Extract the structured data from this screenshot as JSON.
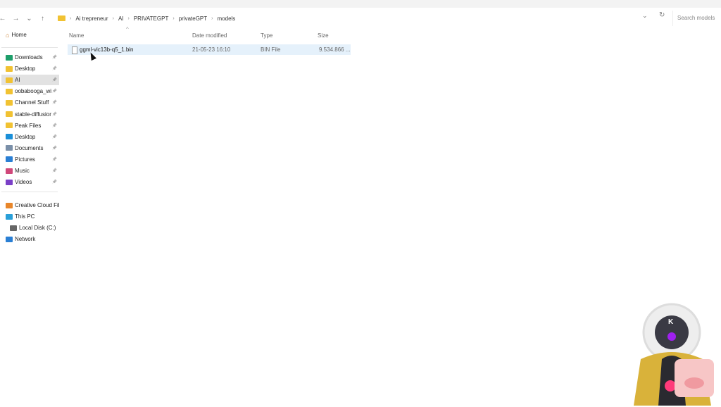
{
  "nav": {
    "back": "←",
    "forward": "→",
    "recent": "⌄",
    "up": "↑"
  },
  "breadcrumb": [
    "Ai trepreneur",
    "AI",
    "PRIVATEGPT",
    "privateGPT",
    "models"
  ],
  "breadcrumb_sep": "›",
  "dropdown": "⌄",
  "refresh": "↻",
  "search": {
    "placeholder": "Search models"
  },
  "sidebar": {
    "home": "Home",
    "quick": [
      {
        "label": "Downloads",
        "color": "#1e9e6a"
      },
      {
        "label": "Desktop",
        "color": "#f1c232"
      },
      {
        "label": "AI",
        "color": "#f1c232"
      },
      {
        "label": "oobabooga_wi",
        "color": "#f1c232"
      },
      {
        "label": "Channel Stuff",
        "color": "#f1c232"
      },
      {
        "label": "stable-diffusior",
        "color": "#f1c232"
      },
      {
        "label": "Peak Files",
        "color": "#f1c232"
      },
      {
        "label": "Desktop",
        "color": "#1a8fd8"
      },
      {
        "label": "Documents",
        "color": "#7a8fa8"
      },
      {
        "label": "Pictures",
        "color": "#2a7fd4"
      },
      {
        "label": "Music",
        "color": "#d0477a"
      },
      {
        "label": "Videos",
        "color": "#7a3fc7"
      }
    ],
    "other": [
      {
        "label": "Creative Cloud File",
        "color": "#e8862a"
      },
      {
        "label": "This PC",
        "color": "#2a9fd8"
      },
      {
        "label": "Local Disk (C:)",
        "color": "#666"
      },
      {
        "label": "Network",
        "color": "#2a7fd4"
      }
    ],
    "pin": "📌"
  },
  "columns": {
    "name": "Name",
    "date": "Date modified",
    "type": "Type",
    "size": "Size"
  },
  "files": [
    {
      "name": "ggml-vic13b-q5_1.bin",
      "date": "21-05-23 16:10",
      "type": "BIN File",
      "size": "9.534.866 ..."
    }
  ],
  "webcam": {
    "badge": "K"
  }
}
